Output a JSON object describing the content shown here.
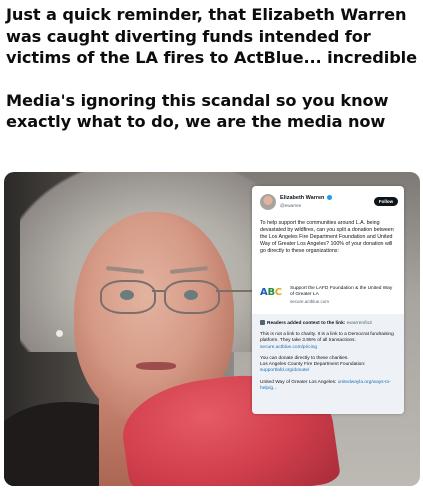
{
  "caption": {
    "paragraph1": "Just a quick reminder, that Elizabeth Warren was caught diverting funds intended for victims of the LA fires to ActBlue... incredible",
    "paragraph2": "Media's ignoring this scandal so you know exactly what to do, we are the media now"
  },
  "tweet": {
    "author_name": "Elizabeth Warren",
    "author_handle": "@ewarren",
    "follow_label": "Follow",
    "body": "To help support the communities around L.A. being devastated by wildfires, can you split a donation between the Los Angeles Fire Department Foundation and United Way of Greater Los Angeles? 100% of your donation will go directly to these organizations:",
    "link_card": {
      "logo": [
        "A",
        "B",
        "C"
      ],
      "title": "Support the LAFD Foundation & the United Way of Greater LA",
      "url": "secure.actblue.com"
    },
    "community_note": {
      "header": "Readers added context to the link:",
      "header_handle": "ewarren/lo3",
      "line1": "This is not a link to charity. It is a link to a Democrat fundraising platform. They take 3.95% of all transactions.",
      "line1_link": "secure.actblue.com/pricing",
      "line2": "You can donate directly to these charities.",
      "line3": "Los Angeles County Fire Department Foundation:",
      "line3_link": "supportlafd.org/donate/",
      "line4": "United Way of Greater Los Angeles:",
      "line4_link": "unitedwayla.org/ways-to-help/g..."
    }
  },
  "colors": {
    "verified": "#1d9bf0",
    "link": "#1d6fb8",
    "note_bg": "#eef2f6",
    "glove": "#d23f4d"
  }
}
